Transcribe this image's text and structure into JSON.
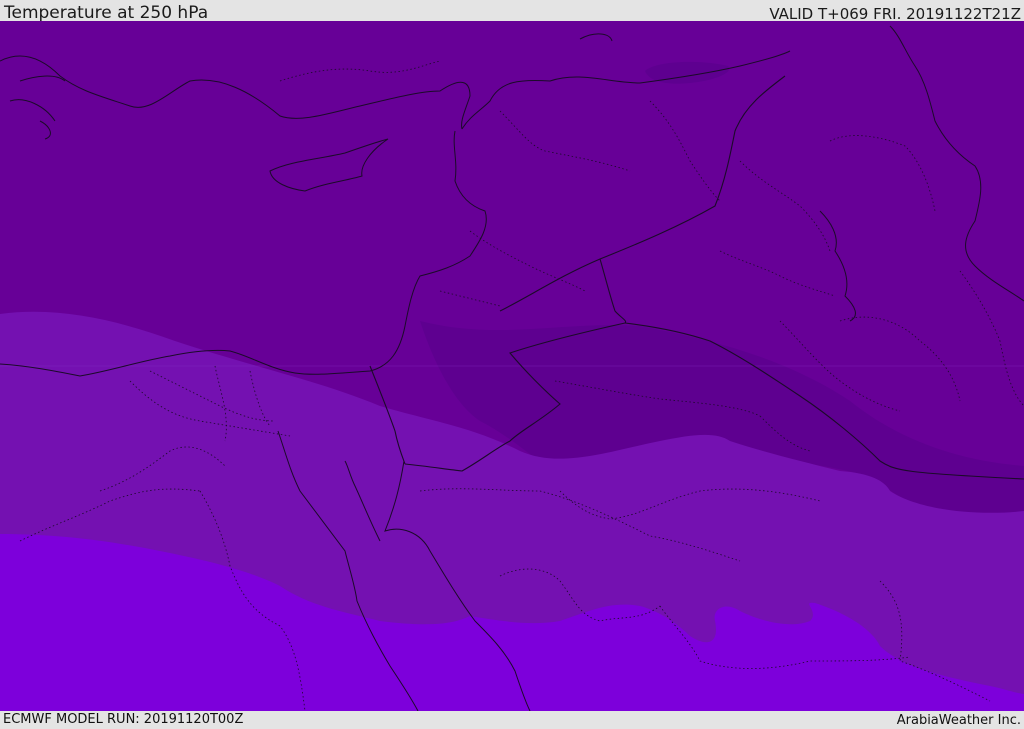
{
  "header": {
    "title": "Temperature at 250 hPa",
    "valid": "VALID T+069 FRI. 20191122T21Z"
  },
  "footer": {
    "model_run": "ECMWF MODEL RUN: 20191120T00Z",
    "credit": "ArabiaWeather Inc."
  },
  "colors": {
    "band_coldest": "#5e0090",
    "band_cold": "#670097",
    "band_mid": "#7411b1",
    "band_warm": "#7d00db",
    "outlines": "#1c0a2a"
  }
}
